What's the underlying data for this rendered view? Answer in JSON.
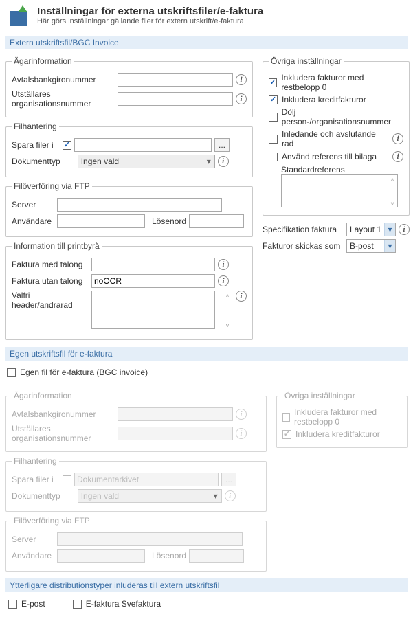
{
  "header": {
    "title": "Inställningar för externa utskriftsfiler/e-faktura",
    "subtitle": "Här görs inställningar gällande filer för extern utskrift/e-faktura"
  },
  "section1": {
    "title": "Extern utskriftsfil/BGC Invoice",
    "owner": {
      "legend": "Ägarinformation",
      "giro_label": "Avtalsbankgironummer",
      "giro_value": "",
      "org_label": "Utställares organisationsnummer",
      "org_value": ""
    },
    "filehandling": {
      "legend": "Filhantering",
      "save_label": "Spara filer i",
      "save_value": "",
      "save_checked": true,
      "browse": "...",
      "doctype_label": "Dokumenttyp",
      "doctype_value": "Ingen vald"
    },
    "ftp": {
      "legend": "Filöverföring via FTP",
      "server_label": "Server",
      "server_value": "",
      "user_label": "Användare",
      "user_value": "",
      "pass_label": "Lösenord",
      "pass_value": ""
    },
    "print": {
      "legend": "Information till printbyrå",
      "with_stub_label": "Faktura med talong",
      "with_stub_value": "",
      "without_stub_label": "Faktura utan talong",
      "without_stub_value": "noOCR",
      "header_label": "Valfri header/andrarad",
      "header_value": ""
    },
    "other": {
      "legend": "Övriga inställningar",
      "cb_rest": "Inkludera fakturor med restbelopp 0",
      "cb_credit": "Inkludera kreditfakturor",
      "cb_hide": "Dölj person-/organisationsnummer",
      "cb_leading": "Inledande och avslutande rad",
      "cb_ref": "Använd referens till bilaga",
      "std_ref_label": "Standardreferens",
      "std_ref_value": "",
      "spec_label": "Specifikation faktura",
      "spec_value": "Layout 1",
      "send_label": "Fakturor skickas som",
      "send_value": "B-post"
    }
  },
  "section2": {
    "title": "Egen utskriftsfil för e-faktura",
    "own_file_label": "Egen fil för e-faktura (BGC invoice)",
    "own_file_checked": false,
    "owner": {
      "legend": "Ägarinformation",
      "giro_label": "Avtalsbankgironummer",
      "org_label": "Utställares organisationsnummer"
    },
    "filehandling": {
      "legend": "Filhantering",
      "save_label": "Spara filer i",
      "save_value": "Dokumentarkivet",
      "browse": "...",
      "doctype_label": "Dokumenttyp",
      "doctype_value": "Ingen vald"
    },
    "ftp": {
      "legend": "Filöverföring via FTP",
      "server_label": "Server",
      "user_label": "Användare",
      "pass_label": "Lösenord"
    },
    "other": {
      "legend": "Övriga inställningar",
      "cb_rest": "Inkludera fakturor med restbelopp 0",
      "cb_credit": "Inkludera kreditfakturor"
    }
  },
  "section3": {
    "title": "Ytterligare distributionstyper inluderas till extern utskriftsfil",
    "cb_epost": "E-post",
    "cb_sve": "E-faktura Svefaktura"
  }
}
